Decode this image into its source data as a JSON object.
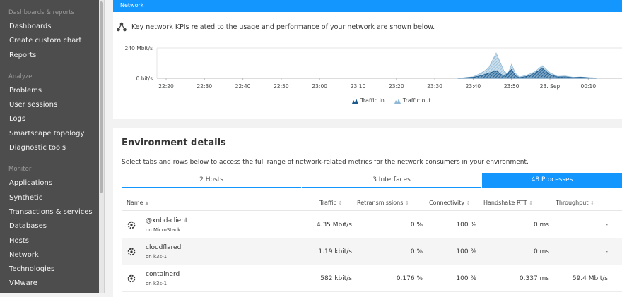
{
  "sidebar": {
    "sections": [
      {
        "title": "Dashboards & reports",
        "items": [
          "Dashboards",
          "Create custom chart",
          "Reports"
        ]
      },
      {
        "title": "Analyze",
        "items": [
          "Problems",
          "User sessions",
          "Logs",
          "Smartscape topology",
          "Diagnostic tools"
        ]
      },
      {
        "title": "Monitor",
        "items": [
          "Applications",
          "Synthetic",
          "Transactions & services",
          "Databases",
          "Hosts",
          "Network",
          "Technologies",
          "VMware"
        ]
      }
    ]
  },
  "network_card": {
    "title": "Network",
    "info": "Key network KPIs related to the usage and performance of your network are shown below."
  },
  "chart_data": {
    "type": "area",
    "y_ticks": [
      "240 Mbit/s",
      "0 bit/s"
    ],
    "ylim": [
      0,
      240
    ],
    "x_ticks": [
      "22:20",
      "22:30",
      "22:40",
      "22:50",
      "23:00",
      "23:10",
      "23:20",
      "23:30",
      "23:40",
      "23:50",
      "23. Sep",
      "00:10"
    ],
    "x": [
      "23:36",
      "23:40",
      "23:42",
      "23:44",
      "23:46",
      "23:48",
      "23:49",
      "23:50",
      "23:51",
      "23:52",
      "23:54",
      "23:56",
      "23:58",
      "00:00",
      "00:02",
      "00:04",
      "00:06",
      "00:08",
      "00:10",
      "00:12"
    ],
    "series": [
      {
        "name": "Traffic in",
        "color": "#1a5a8e",
        "values": [
          0,
          8,
          20,
          40,
          60,
          15,
          40,
          70,
          20,
          5,
          15,
          40,
          80,
          30,
          10,
          12,
          5,
          8,
          4,
          2
        ]
      },
      {
        "name": "Traffic out",
        "color": "#8fb8d6",
        "values": [
          0,
          12,
          40,
          80,
          200,
          60,
          30,
          110,
          40,
          10,
          25,
          50,
          100,
          45,
          15,
          18,
          8,
          10,
          6,
          3
        ]
      }
    ],
    "legend": [
      "Traffic in",
      "Traffic out"
    ]
  },
  "environment": {
    "title": "Environment details",
    "description": "Select tabs and rows below to access the full range of network-related metrics for the network consumers in your environment.",
    "tabs": [
      "2 Hosts",
      "3 Interfaces",
      "48 Processes"
    ],
    "active_tab": 2,
    "columns": {
      "name": "Name",
      "traffic": "Traffic",
      "retransmissions": "Retransmissions",
      "connectivity": "Connectivity",
      "handshake": "Handshake RTT",
      "throughput": "Throughput"
    },
    "rows": [
      {
        "name": "@xnbd-client",
        "host": "on MicroStack",
        "traffic": "4.35 Mbit/s",
        "retransmissions": "0 %",
        "connectivity": "100 %",
        "handshake": "0 ms",
        "throughput": "-"
      },
      {
        "name": "cloudflared",
        "host": "on k3s-1",
        "traffic": "1.19 kbit/s",
        "retransmissions": "0 %",
        "connectivity": "100 %",
        "handshake": "0 ms",
        "throughput": "-"
      },
      {
        "name": "containerd",
        "host": "on k3s-1",
        "traffic": "582 kbit/s",
        "retransmissions": "0.176 %",
        "connectivity": "100 %",
        "handshake": "0.337 ms",
        "throughput": "59.4 Mbit/s"
      }
    ]
  }
}
